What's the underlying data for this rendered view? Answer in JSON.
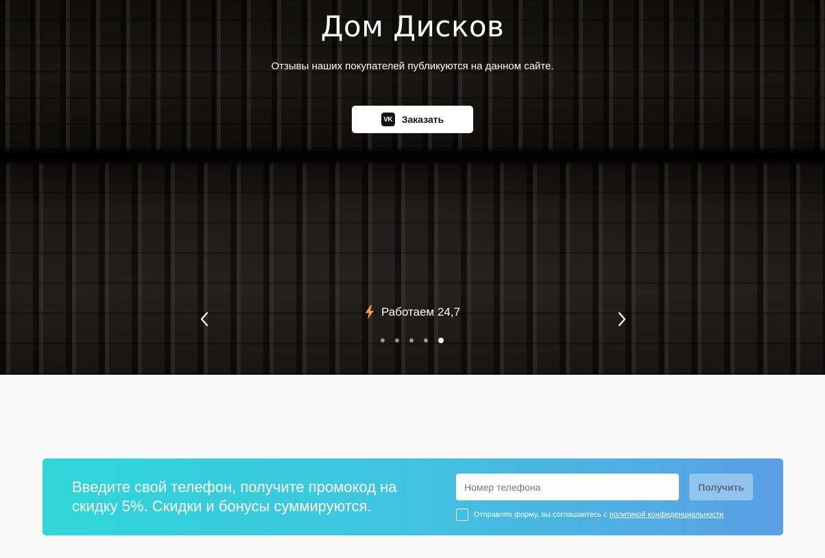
{
  "hero": {
    "title": "Дом Дисков",
    "subtitle": "Отзывы наших покупателей публикуются на данном сайте.",
    "order_button": {
      "label": "Заказать",
      "icon": "vk-icon",
      "icon_text": "VK"
    },
    "slide_text": "Работаем 24,7",
    "slide_icon": "lightning-icon",
    "slides_total": 5,
    "active_slide": 5,
    "colors": {
      "bolt": "#f2994a"
    }
  },
  "promo": {
    "text": "Введите свой телефон, получите промокод на скидку 5%. Скидки и бонусы суммируются.",
    "phone_placeholder": "Номер телефона",
    "submit_label": "Получить",
    "consent_text": "Отправляя форму, вы соглашаетесь с",
    "consent_link": "политикой конфиденциальности",
    "colors": {
      "gradient_start": "#2fd6d8",
      "gradient_end": "#5a9fe6"
    }
  }
}
